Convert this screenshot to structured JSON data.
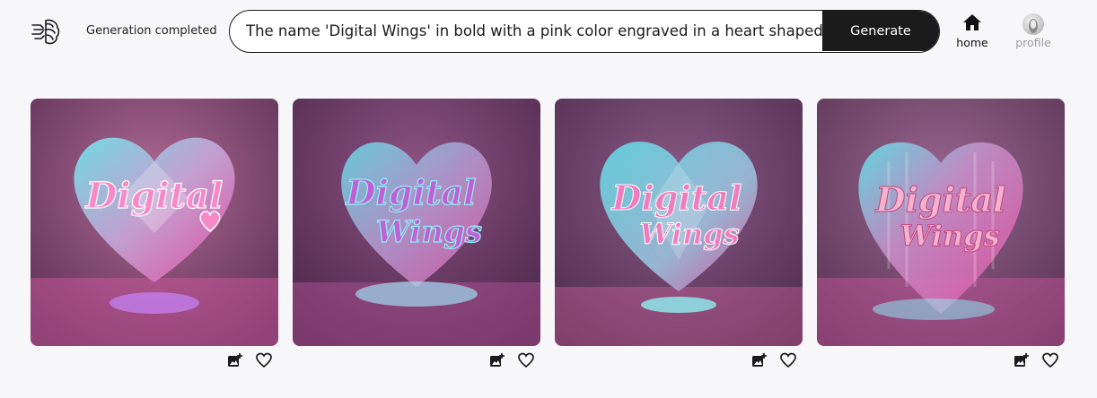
{
  "header": {
    "status": "Generation completed",
    "prompt_value": "The name 'Digital Wings' in bold with a pink color engraved in a heart shaped",
    "generate_label": "Generate",
    "nav": [
      {
        "label": "home",
        "icon": "home-icon",
        "active": true
      },
      {
        "label": "profile",
        "icon": "profile-avatar-icon",
        "active": false
      }
    ]
  },
  "gallery": {
    "images": [
      {
        "text_line1": "Digital",
        "text_line2": ""
      },
      {
        "text_line1": "Digital",
        "text_line2": "Wings"
      },
      {
        "text_line1": "Digital",
        "text_line2": "Wings"
      },
      {
        "text_line1": "Digital",
        "text_line2": "Wings"
      }
    ],
    "actions": [
      {
        "icon": "add-image-icon"
      },
      {
        "icon": "heart-icon"
      }
    ]
  },
  "colors": {
    "accent_dark": "#1b1b1b",
    "background": "#f7f7f9",
    "image_pink": "#e8559f",
    "image_cyan": "#5fe3ea",
    "image_purple": "#7a4878"
  }
}
